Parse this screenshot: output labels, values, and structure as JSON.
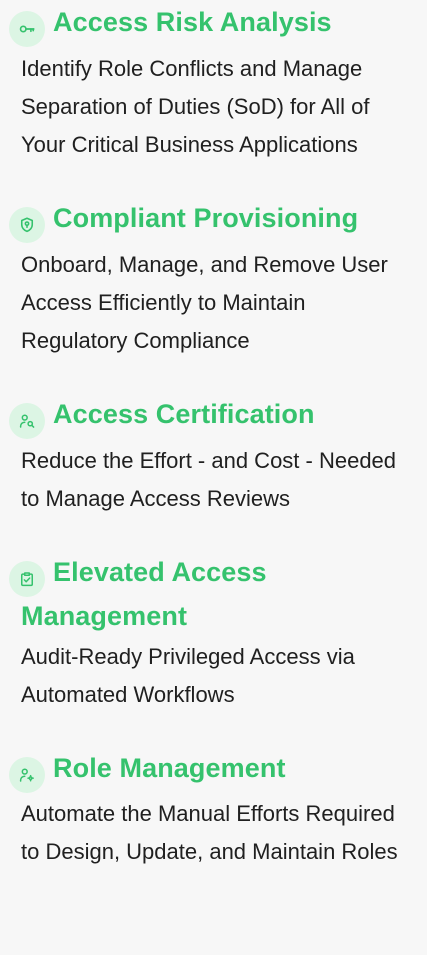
{
  "accent": "#35c26d",
  "icon_bg": "#dcf5e4",
  "features": [
    {
      "icon": "key-icon",
      "title": "Access Risk Analysis",
      "description": "Identify Role Conflicts and Manage Separation of Duties (SoD) for All of Your Critical Business Applications"
    },
    {
      "icon": "shield-icon",
      "title": "Compliant Provisioning",
      "description": "Onboard, Manage, and Remove User Access Efficiently to Maintain Regulatory Compliance"
    },
    {
      "icon": "user-search-icon",
      "title": "Access Certification",
      "description": "Reduce the Effort - and Cost - Needed to Manage Access Reviews"
    },
    {
      "icon": "clipboard-check-icon",
      "title": "Elevated Access Management",
      "description": "Audit-Ready Privileged Access via Automated Workflows"
    },
    {
      "icon": "user-settings-icon",
      "title": "Role Management",
      "description": "Automate the Manual Efforts Required to Design, Update, and Maintain Roles"
    }
  ]
}
